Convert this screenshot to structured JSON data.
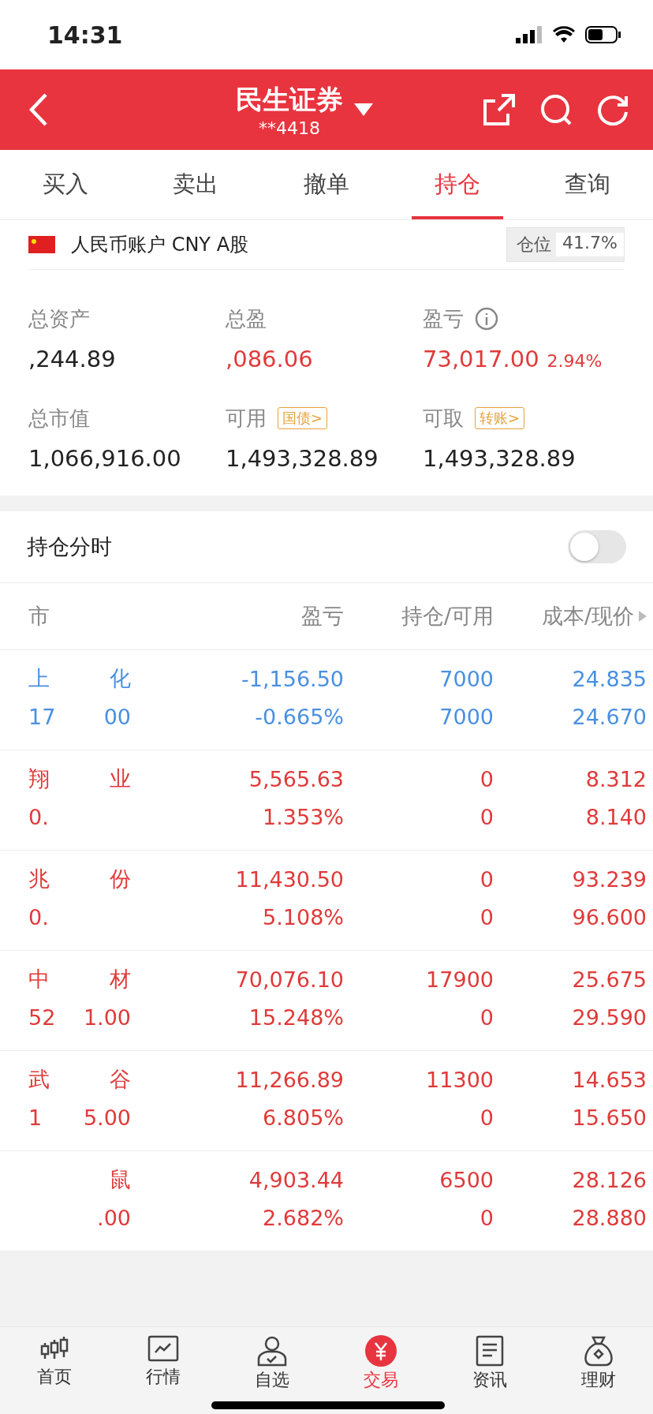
{
  "status_bar": {
    "time": "14:31"
  },
  "header": {
    "title": "民生证券",
    "account": "**4418"
  },
  "tabs": [
    {
      "label": "买入",
      "selected": false
    },
    {
      "label": "卖出",
      "selected": false
    },
    {
      "label": "撤单",
      "selected": false
    },
    {
      "label": "持仓",
      "selected": true
    },
    {
      "label": "查询",
      "selected": false
    }
  ],
  "account": {
    "label": "人民币账户 CNY A股",
    "position_label": "仓位",
    "position_value": "41.7%"
  },
  "summary": [
    {
      "label": "总资产",
      "value": ",244.89",
      "kind": "plain"
    },
    {
      "label": "总盈",
      "value": ",086.06",
      "kind": "gain"
    },
    {
      "label": "盈亏",
      "value": "73,017.00",
      "percent": "2.94%",
      "kind": "gain",
      "info": true
    }
  ],
  "funds": [
    {
      "label": "总市值",
      "value": "1,066,916.00"
    },
    {
      "label": "可用",
      "tag": "国债>",
      "value": "1,493,328.89"
    },
    {
      "label": "可取",
      "tag": "转账>",
      "value": "1,493,328.89"
    }
  ],
  "intraday": {
    "label": "持仓分时",
    "on": false
  },
  "table": {
    "columns": [
      "市",
      "盈亏",
      "持仓/可用",
      "成本/现价"
    ],
    "rows": [
      {
        "kind": "loss",
        "name_start": "上",
        "name_end": "化",
        "value_start": "17",
        "value_end": "00",
        "pl": "-1,156.50",
        "pl_pct": "-0.665%",
        "hold": "7000",
        "avail": "7000",
        "cost": "24.835",
        "price": "24.670"
      },
      {
        "kind": "gain",
        "name_start": "翔",
        "name_end": "业",
        "value_start": "0.",
        "pl": "5,565.63",
        "pl_pct": "1.353%",
        "hold": "0",
        "avail": "0",
        "cost": "8.312",
        "price": "8.140"
      },
      {
        "kind": "gain",
        "name_start": "兆",
        "name_end": "份",
        "value_start": "0.",
        "pl": "11,430.50",
        "pl_pct": "5.108%",
        "hold": "0",
        "avail": "0",
        "cost": "93.239",
        "price": "96.600"
      },
      {
        "kind": "gain",
        "name_start": "中",
        "name_end": "材",
        "value_start": "52",
        "value_end": "1.00",
        "pl": "70,076.10",
        "pl_pct": "15.248%",
        "hold": "17900",
        "avail": "0",
        "cost": "25.675",
        "price": "29.590"
      },
      {
        "kind": "gain",
        "name_start": "武",
        "name_end": "谷",
        "value_start": "1",
        "value_end": "5.00",
        "pl": "11,266.89",
        "pl_pct": "6.805%",
        "hold": "11300",
        "avail": "0",
        "cost": "14.653",
        "price": "15.650"
      },
      {
        "kind": "gain",
        "name_end": "鼠",
        "value_end": ".00",
        "pl": "4,903.44",
        "pl_pct": "2.682%",
        "hold": "6500",
        "avail": "0",
        "cost": "28.126",
        "price": "28.880"
      }
    ]
  },
  "nav": [
    {
      "label": "首页",
      "kind": "candles",
      "selected": false
    },
    {
      "label": "行情",
      "kind": "chart",
      "selected": false
    },
    {
      "label": "自选",
      "kind": "person",
      "selected": false
    },
    {
      "label": "交易",
      "kind": "yen",
      "selected": true
    },
    {
      "label": "资讯",
      "kind": "doc",
      "selected": false
    },
    {
      "label": "理财",
      "kind": "bag",
      "selected": false
    }
  ]
}
